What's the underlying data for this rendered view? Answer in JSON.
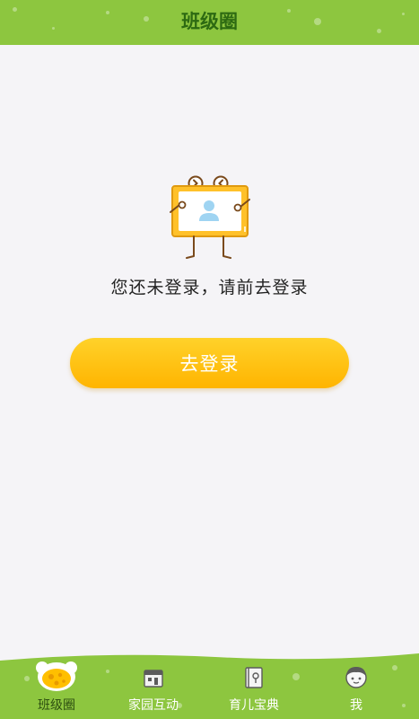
{
  "header": {
    "title": "班级圈"
  },
  "empty_state": {
    "illustration_icon": "tv-person-icon",
    "message": "您还未登录，请前去登录"
  },
  "login_button": {
    "label": "去登录"
  },
  "tabbar": {
    "tabs": [
      {
        "label": "班级圈",
        "icon": "class-circle-icon",
        "active": true
      },
      {
        "label": "家园互动",
        "icon": "home-interaction-icon",
        "active": false
      },
      {
        "label": "育儿宝典",
        "icon": "parenting-book-icon",
        "active": false
      },
      {
        "label": "我",
        "icon": "me-avatar-icon",
        "active": false
      }
    ]
  },
  "colors": {
    "header_bg": "#8dc63f",
    "title_text": "#2d6a12",
    "accent": "#ffbf00",
    "page_bg": "#f5f4f7",
    "tabbar_bg": "#8dc63f"
  }
}
